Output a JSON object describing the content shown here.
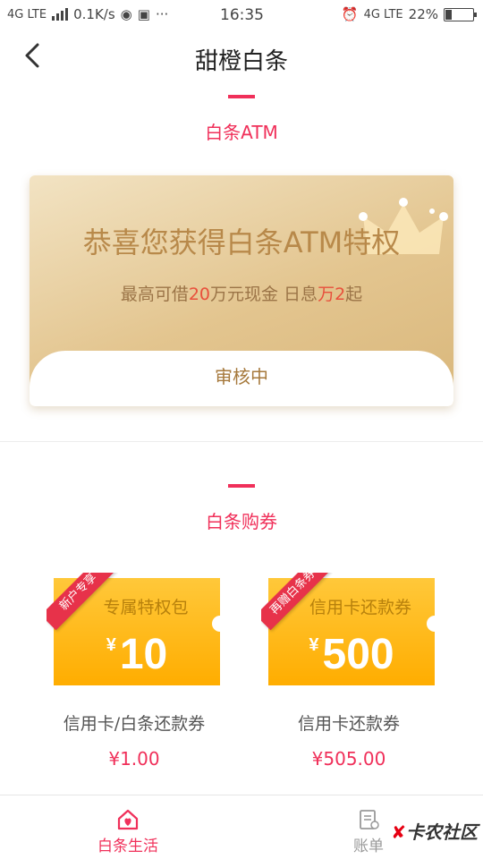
{
  "status_bar": {
    "network_left": "4G LTE",
    "speed": "0.1K/s",
    "dots": "···",
    "time": "16:35",
    "network_right": "4G LTE",
    "battery": "22%",
    "battery_level": 0.22
  },
  "header": {
    "title": "甜橙白条",
    "back_icon": "chevron-left-icon"
  },
  "atm_section": {
    "title": "白条ATM",
    "headline": "恭喜您获得白条ATM特权",
    "sub_prefix": "最高可借",
    "sub_amount": "20",
    "sub_mid": "万元现金 日息",
    "sub_rate_unit": "万",
    "sub_rate": "2",
    "sub_suffix": "起",
    "status": "审核中"
  },
  "coupon_section": {
    "title": "白条购券",
    "coupons": [
      {
        "ribbon": "新户专享",
        "title": "专属特权包",
        "currency": "¥",
        "value": "10",
        "name": "信用卡/白条还款券",
        "price": "¥1.00"
      },
      {
        "ribbon": "再赠白条券",
        "title": "信用卡还款券",
        "currency": "¥",
        "value": "500",
        "name": "信用卡还款券",
        "price": "¥505.00"
      }
    ]
  },
  "tab_bar": {
    "tabs": [
      {
        "label": "白条生活",
        "icon": "heart-home-icon",
        "active": true
      },
      {
        "label": "账单",
        "icon": "bill-icon",
        "active": false
      }
    ],
    "watermark": "卡农社区"
  },
  "colors": {
    "accent": "#f0305a",
    "gold_text": "#b8894a",
    "coupon": "#ffb400"
  }
}
